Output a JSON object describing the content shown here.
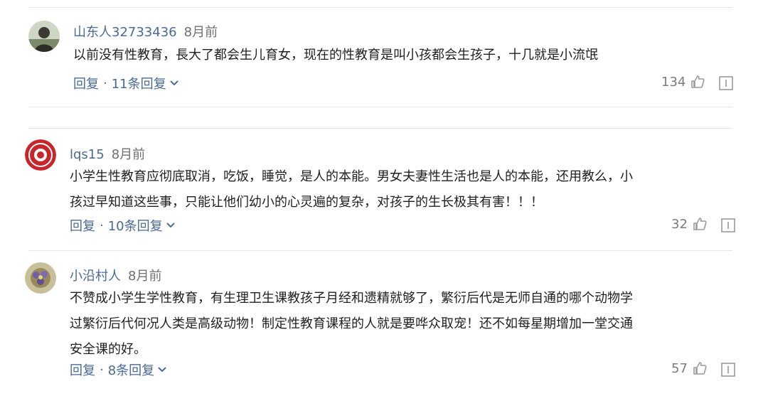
{
  "comments": [
    {
      "username": "山东人32733436",
      "time": "8月前",
      "lines": [
        "以前没有性教育，長大了都会生儿育女，现在的性教育是叫小孩都会生孩子，十几就是小流氓"
      ],
      "reply_label": "回复",
      "separator": "·",
      "replies_count": "11条回复",
      "likes": "134",
      "avatar_icon": "user-photo-avatar"
    },
    {
      "username": "lqs15",
      "time": "8月前",
      "lines": [
        "小学生性教育应彻底取消，吃饭，睡觉，是人的本能。男女夫妻性生活也是人的本能，还用教么，小",
        "孩过早知道这些事，只能让他们幼小的心灵遍的复杂，对孩子的生长极其有害！！！"
      ],
      "reply_label": "回复",
      "separator": "·",
      "replies_count": "10条回复",
      "likes": "32",
      "avatar_icon": "red-emblem-avatar"
    },
    {
      "username": "小沿村人",
      "time": "8月前",
      "lines": [
        "不赞成小学生学性教育，有生理卫生课教孩子月经和遗精就够了，繁衍后代是无师自通的哪个动物学",
        "过繁衍后代何况人类是高级动物！制定性教育课程的人就是要哗众取宠！还不如每星期增加一堂交通",
        "安全课的好。"
      ],
      "reply_label": "回复",
      "separator": "·",
      "replies_count": "8条回复",
      "likes": "57",
      "avatar_icon": "flower-avatar"
    }
  ],
  "colors": {
    "username": "#4a6a96",
    "time": "#6f6f6f",
    "body_text": "#1f1f1f",
    "icon_gray": "#9a9a9a",
    "separator": "#e6e6e6"
  }
}
